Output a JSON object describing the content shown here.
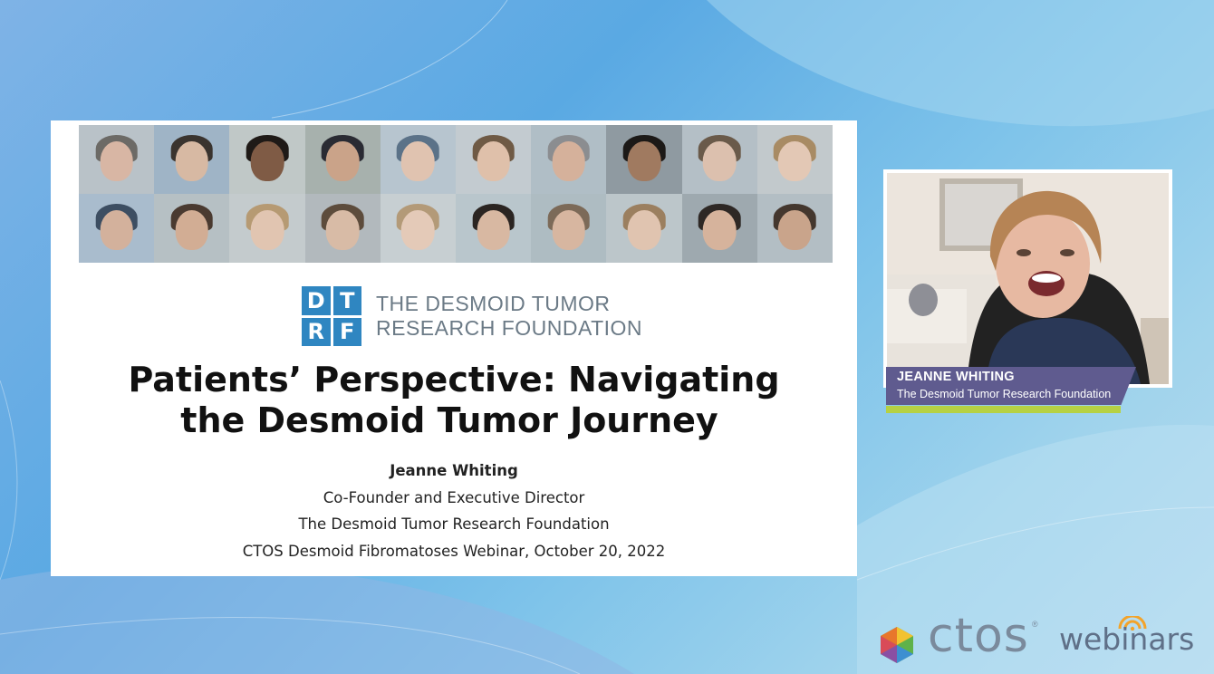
{
  "slide": {
    "photo_grid_alt": "Desmoid tumor patient photos",
    "logo": {
      "mark_letters": [
        "D",
        "T",
        "R",
        "F"
      ],
      "line1": "THE DESMOID TUMOR",
      "line2": "RESEARCH FOUNDATION"
    },
    "title_line1": "Patients’ Perspective: Navigating",
    "title_line2": "the Desmoid Tumor Journey",
    "presenter_name": "Jeanne Whiting",
    "presenter_role": "Co-Founder and Executive Director",
    "presenter_org": "The Desmoid Tumor Research Foundation",
    "event": "CTOS Desmoid Fibromatoses Webinar, October 20, 2022"
  },
  "camera": {
    "speaker_name": "JEANNE WHITING",
    "speaker_org": "The Desmoid Tumor Research Foundation"
  },
  "branding": {
    "ctos": "ctos",
    "registered": "®",
    "webinars": "webinars"
  },
  "colors": {
    "dtrf_blue": "#2f86c1",
    "nameplate_purple": "#5f5b8f",
    "nameplate_green": "#b6d143",
    "brand_gray": "#7a8a9c"
  }
}
